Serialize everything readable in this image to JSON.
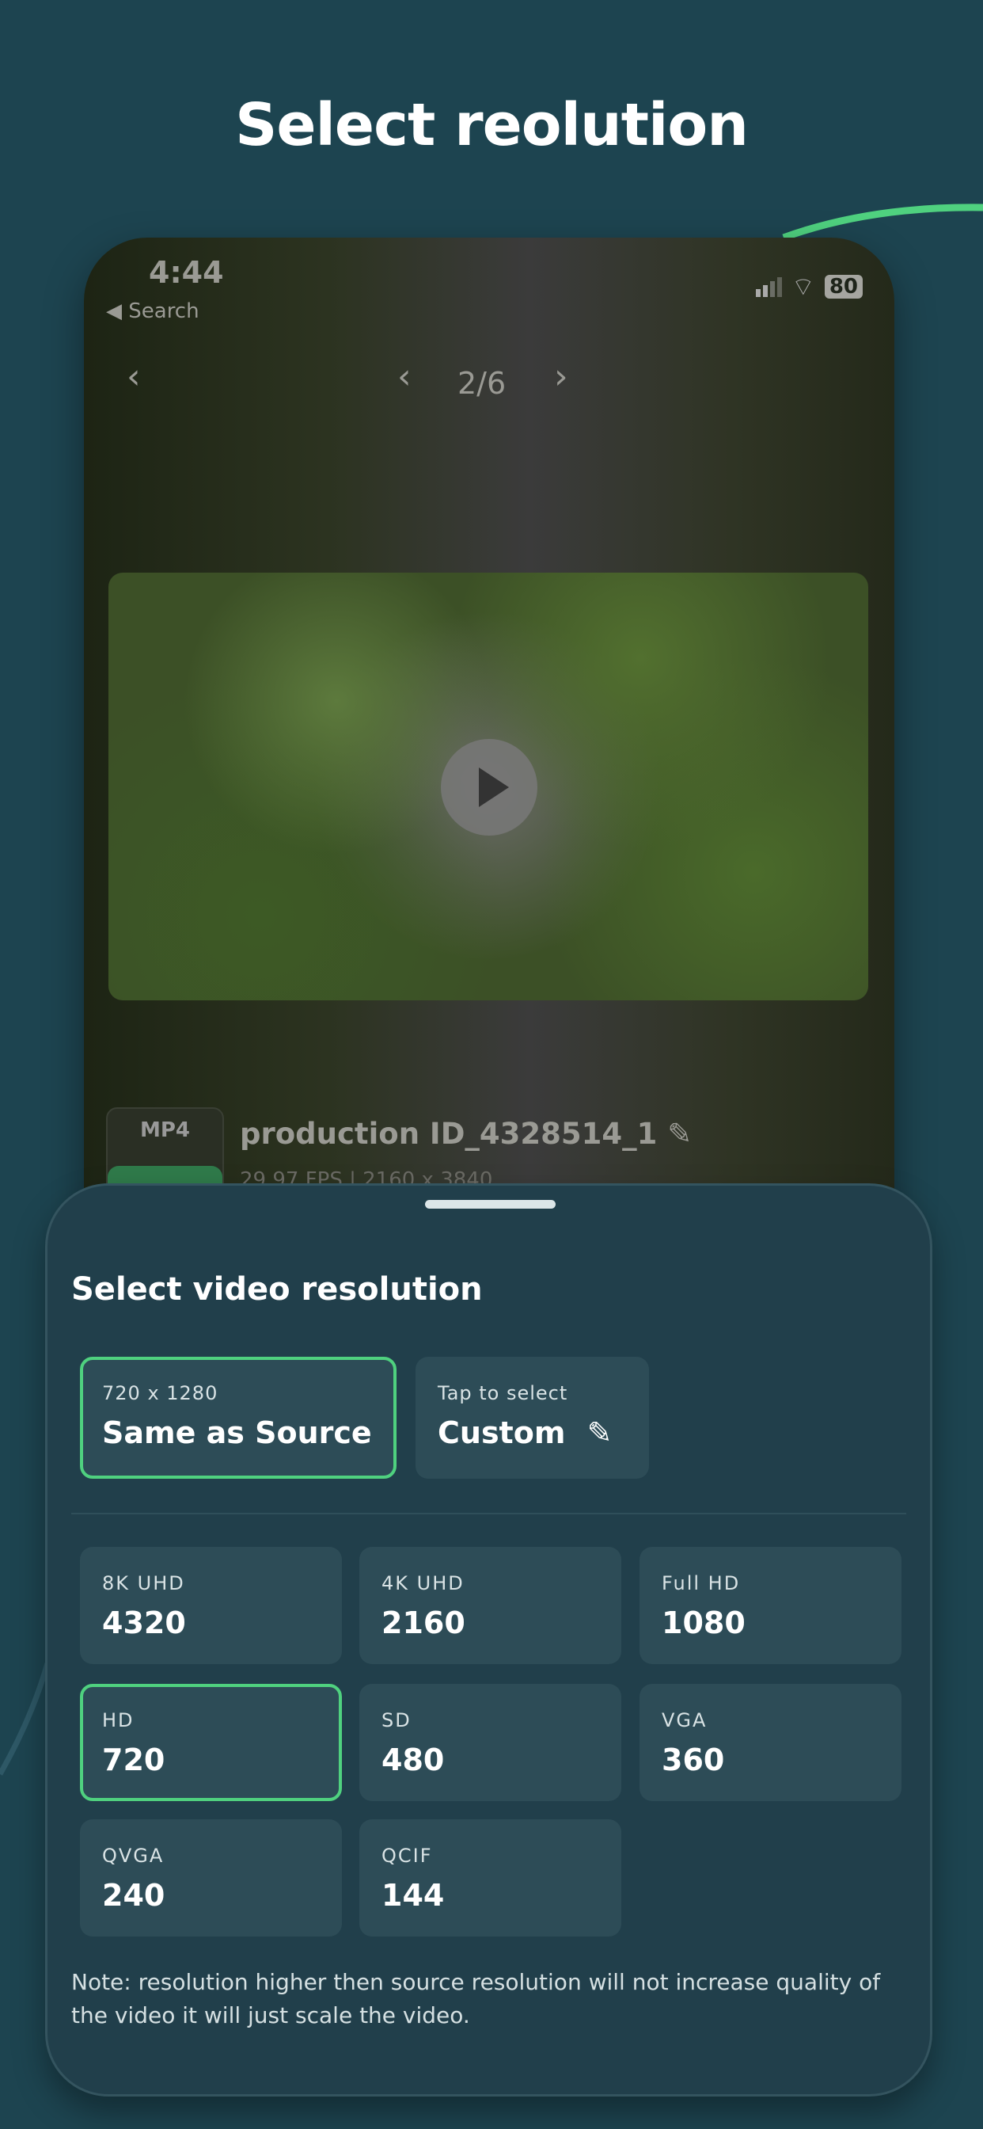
{
  "headline": "Select reolution",
  "phone": {
    "status": {
      "time": "4:44",
      "back": "◀ Search",
      "battery": "80"
    },
    "nav": {
      "back": "‹",
      "prev": "‹",
      "page": "2/6",
      "next": "›"
    },
    "file": {
      "format": "MP4",
      "name": "production ID_4328514_1",
      "meta": "29.97 FPS  |  2160 x 3840"
    }
  },
  "sheet": {
    "title": "Select video resolution",
    "source": {
      "label": "720 x 1280",
      "value": "Same as Source",
      "selected": true
    },
    "custom": {
      "label": "Tap to select",
      "value": "Custom"
    },
    "options": [
      {
        "label": "8K UHD",
        "value": "4320"
      },
      {
        "label": "4K UHD",
        "value": "2160"
      },
      {
        "label": "Full HD",
        "value": "1080"
      },
      {
        "label": "HD",
        "value": "720",
        "selected": true
      },
      {
        "label": "SD",
        "value": "480"
      },
      {
        "label": "VGA",
        "value": "360"
      },
      {
        "label": "QVGA",
        "value": "240"
      },
      {
        "label": "QCIF",
        "value": "144"
      }
    ],
    "note": "Note: resolution higher then source resolution will not increase quality of the video it will just scale the video."
  },
  "colors": {
    "background": "#1d4450",
    "accent": "#4fd17f",
    "card": "#2d4c57"
  }
}
